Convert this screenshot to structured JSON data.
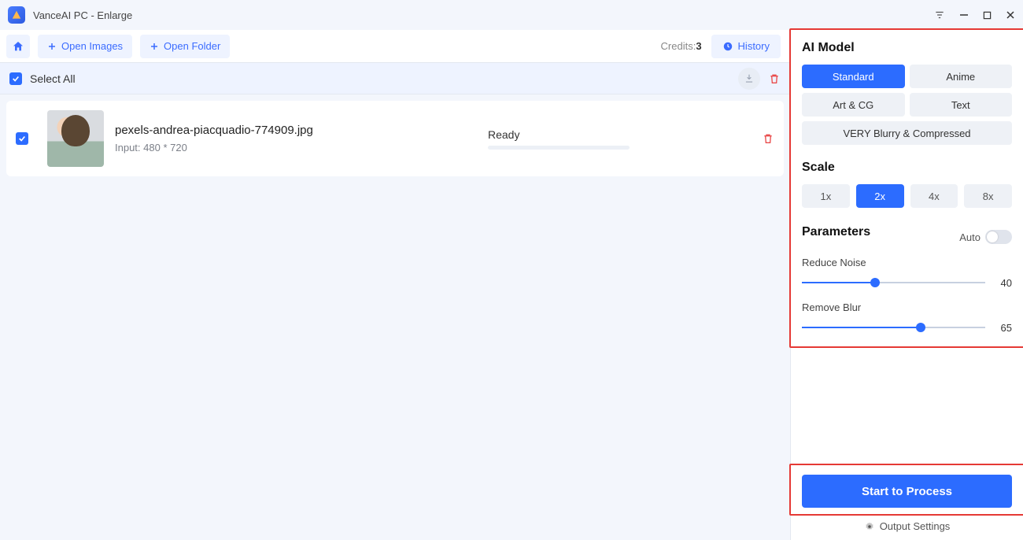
{
  "titlebar": {
    "title": "VanceAI PC - Enlarge"
  },
  "toolbar": {
    "open_images": "Open Images",
    "open_folder": "Open Folder",
    "credits_label": "Credits:",
    "credits_value": "3",
    "history": "History"
  },
  "list": {
    "select_all": "Select All",
    "items": [
      {
        "filename": "pexels-andrea-piacquadio-774909.jpg",
        "dimensions": "Input: 480 * 720",
        "status": "Ready"
      }
    ]
  },
  "panel": {
    "ai_model": {
      "heading": "AI Model",
      "options": [
        "Standard",
        "Anime",
        "Art & CG",
        "Text",
        "VERY Blurry & Compressed"
      ],
      "selected": "Standard"
    },
    "scale": {
      "heading": "Scale",
      "options": [
        "1x",
        "2x",
        "4x",
        "8x"
      ],
      "selected": "2x"
    },
    "parameters": {
      "heading": "Parameters",
      "auto_label": "Auto",
      "auto": false,
      "reduce_noise": {
        "label": "Reduce Noise",
        "value": 40
      },
      "remove_blur": {
        "label": "Remove Blur",
        "value": 65
      }
    },
    "process_button": "Start to Process",
    "output_settings": "Output Settings"
  }
}
